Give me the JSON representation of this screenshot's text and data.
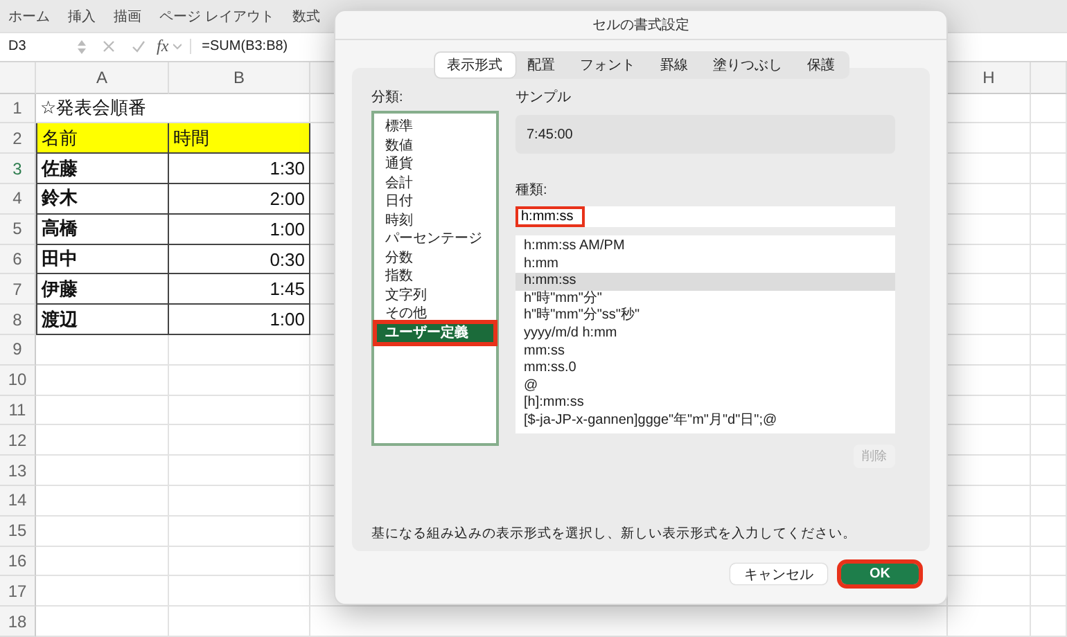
{
  "ribbon": {
    "tabs": [
      "ホーム",
      "挿入",
      "描画",
      "ページ レイアウト",
      "数式"
    ]
  },
  "formula_bar": {
    "cell_ref": "D3",
    "fx": "fx",
    "formula": "=SUM(B3:B8)"
  },
  "sheet": {
    "columns": [
      "A",
      "B",
      "H"
    ],
    "rows": [
      {
        "number": "1",
        "kind": "title",
        "active": false,
        "cells": [
          "☆発表会順番"
        ]
      },
      {
        "number": "2",
        "kind": "header",
        "active": false,
        "cells": [
          "名前",
          "時間"
        ]
      },
      {
        "number": "3",
        "kind": "data",
        "active": true,
        "cells": [
          "佐藤",
          "1:30"
        ]
      },
      {
        "number": "4",
        "kind": "data",
        "active": false,
        "cells": [
          "鈴木",
          "2:00"
        ]
      },
      {
        "number": "5",
        "kind": "data",
        "active": false,
        "cells": [
          "高橋",
          "1:00"
        ]
      },
      {
        "number": "6",
        "kind": "data",
        "active": false,
        "cells": [
          "田中",
          "0:30"
        ]
      },
      {
        "number": "7",
        "kind": "data",
        "active": false,
        "cells": [
          "伊藤",
          "1:45"
        ]
      },
      {
        "number": "8",
        "kind": "data",
        "active": false,
        "cells": [
          "渡辺",
          "1:00"
        ]
      },
      {
        "number": "9",
        "kind": "empty",
        "active": false,
        "cells": []
      },
      {
        "number": "10",
        "kind": "empty",
        "active": false,
        "cells": []
      },
      {
        "number": "11",
        "kind": "empty",
        "active": false,
        "cells": []
      },
      {
        "number": "12",
        "kind": "empty",
        "active": false,
        "cells": []
      },
      {
        "number": "13",
        "kind": "empty",
        "active": false,
        "cells": []
      },
      {
        "number": "14",
        "kind": "empty",
        "active": false,
        "cells": []
      },
      {
        "number": "15",
        "kind": "empty",
        "active": false,
        "cells": []
      },
      {
        "number": "16",
        "kind": "empty",
        "active": false,
        "cells": []
      },
      {
        "number": "17",
        "kind": "empty",
        "active": false,
        "cells": []
      },
      {
        "number": "18",
        "kind": "empty",
        "active": false,
        "cells": []
      }
    ]
  },
  "dialog": {
    "title": "セルの書式設定",
    "tabs": [
      {
        "label": "表示形式",
        "selected": true
      },
      {
        "label": "配置",
        "selected": false
      },
      {
        "label": "フォント",
        "selected": false
      },
      {
        "label": "罫線",
        "selected": false
      },
      {
        "label": "塗りつぶし",
        "selected": false
      },
      {
        "label": "保護",
        "selected": false
      }
    ],
    "category_label": "分類:",
    "categories": [
      {
        "label": "標準",
        "selected": false,
        "highlighted": false
      },
      {
        "label": "数値",
        "selected": false,
        "highlighted": false
      },
      {
        "label": "通貨",
        "selected": false,
        "highlighted": false
      },
      {
        "label": "会計",
        "selected": false,
        "highlighted": false
      },
      {
        "label": "日付",
        "selected": false,
        "highlighted": false
      },
      {
        "label": "時刻",
        "selected": false,
        "highlighted": false
      },
      {
        "label": "パーセンテージ",
        "selected": false,
        "highlighted": false
      },
      {
        "label": "分数",
        "selected": false,
        "highlighted": false
      },
      {
        "label": "指数",
        "selected": false,
        "highlighted": false
      },
      {
        "label": "文字列",
        "selected": false,
        "highlighted": false
      },
      {
        "label": "その他",
        "selected": false,
        "highlighted": false
      },
      {
        "label": "ユーザー定義",
        "selected": true,
        "highlighted": true
      }
    ],
    "sample_label": "サンプル",
    "sample_value": "7:45:00",
    "type_label": "種類:",
    "type_input": {
      "value": "h:mm:ss",
      "highlighted": true
    },
    "types": [
      {
        "label": "h:mm:ss AM/PM",
        "selected": false
      },
      {
        "label": "h:mm",
        "selected": false
      },
      {
        "label": "h:mm:ss",
        "selected": true
      },
      {
        "label": "h\"時\"mm\"分\"",
        "selected": false
      },
      {
        "label": "h\"時\"mm\"分\"ss\"秒\"",
        "selected": false
      },
      {
        "label": "yyyy/m/d h:mm",
        "selected": false
      },
      {
        "label": "mm:ss",
        "selected": false
      },
      {
        "label": "mm:ss.0",
        "selected": false
      },
      {
        "label": "@",
        "selected": false
      },
      {
        "label": "[h]:mm:ss",
        "selected": false
      },
      {
        "label": "[$-ja-JP-x-gannen]ggge\"年\"m\"月\"d\"日\";@",
        "selected": false
      }
    ],
    "delete_button": {
      "label": "削除",
      "disabled": true
    },
    "hint": "基になる組み込みの表示形式を選択し、新しい表示形式を入力してください。",
    "cancel_button": {
      "label": "キャンセル",
      "highlighted": false
    },
    "ok_button": {
      "label": "OK",
      "highlighted": true
    }
  }
}
